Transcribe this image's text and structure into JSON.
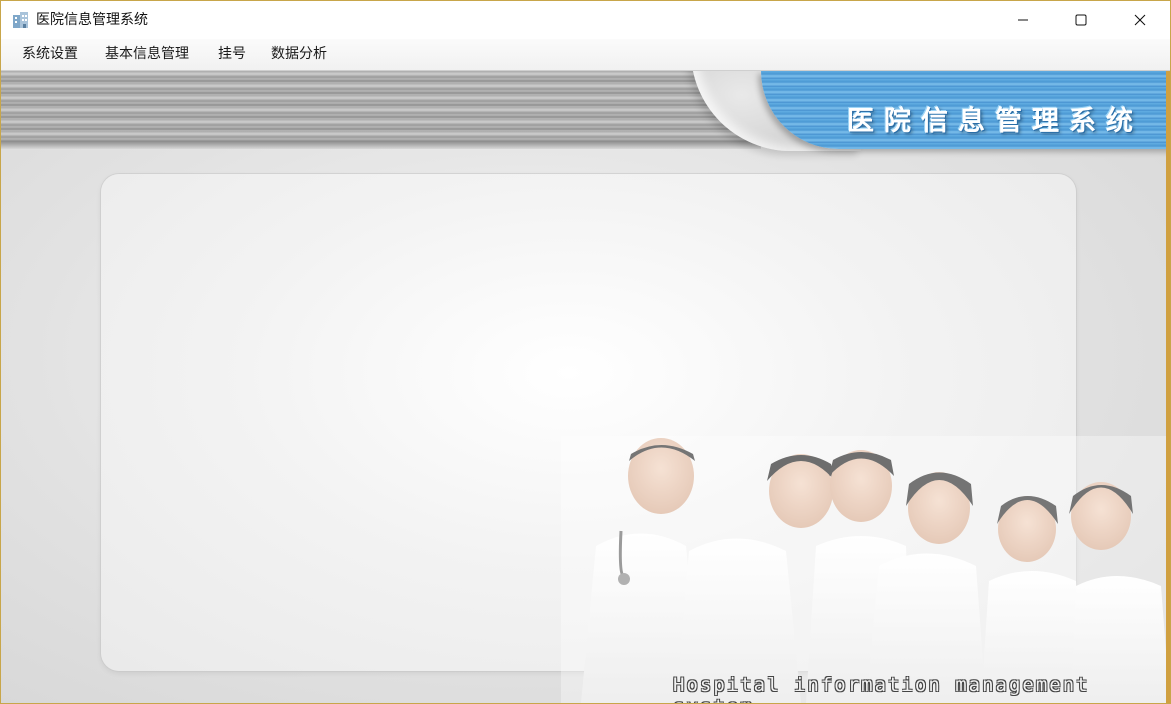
{
  "window": {
    "title": "医院信息管理系统",
    "app_icon": "hospital-building-icon",
    "controls": [
      "minimize-icon",
      "maximize-icon",
      "close-icon"
    ]
  },
  "menu": {
    "items": [
      {
        "label": "系统设置"
      },
      {
        "label": "基本信息管理"
      },
      {
        "label": "挂号"
      },
      {
        "label": "数据分析"
      }
    ]
  },
  "banner": {
    "title": "医院信息管理系统",
    "accent_color": "#4b98d4"
  },
  "footer": {
    "caption": "Hospital information management system"
  }
}
